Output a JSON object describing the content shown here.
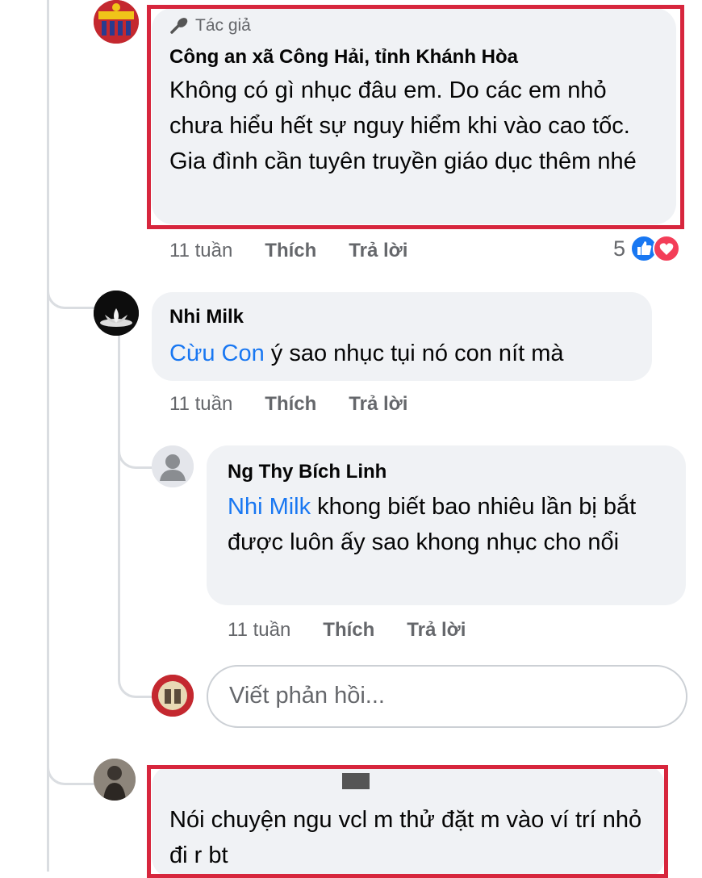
{
  "comments": [
    {
      "author_badge": "Tác giả",
      "author": "Công an xã Công Hải, tỉnh Khánh Hòa",
      "text": "Không có gì nhục đâu em. Do các em nhỏ chưa hiểu hết sự nguy hiểm khi vào cao tốc. Gia đình cần tuyên truyền giáo dục thêm nhé",
      "time": "11 tuần",
      "like_label": "Thích",
      "reply_label": "Trả lời",
      "reaction_count": "5"
    },
    {
      "author": "Nhi Milk",
      "mention": "Cừu Con",
      "text": " ý sao nhục tụi nó con nít mà",
      "time": "11 tuần",
      "like_label": "Thích",
      "reply_label": "Trả lời"
    },
    {
      "author": "Ng Thy Bích Linh",
      "mention": "Nhi Milk",
      "text": " khong biết bao nhiêu lần bị bắt được luôn ấy sao khong nhục cho nổi",
      "time": "11 tuần",
      "like_label": "Thích",
      "reply_label": "Trả lời"
    },
    {
      "author": "",
      "text": "Nói chuyện ngu vcl m thử đặt m vào ví trí nhỏ đi r bt"
    }
  ],
  "reply_input": {
    "placeholder": "Viết phản hồi..."
  },
  "colors": {
    "highlight": "#d7263d",
    "mention": "#1877f2",
    "bubble": "#f0f2f5",
    "like": "#1877f2",
    "love": "#f33e58"
  }
}
